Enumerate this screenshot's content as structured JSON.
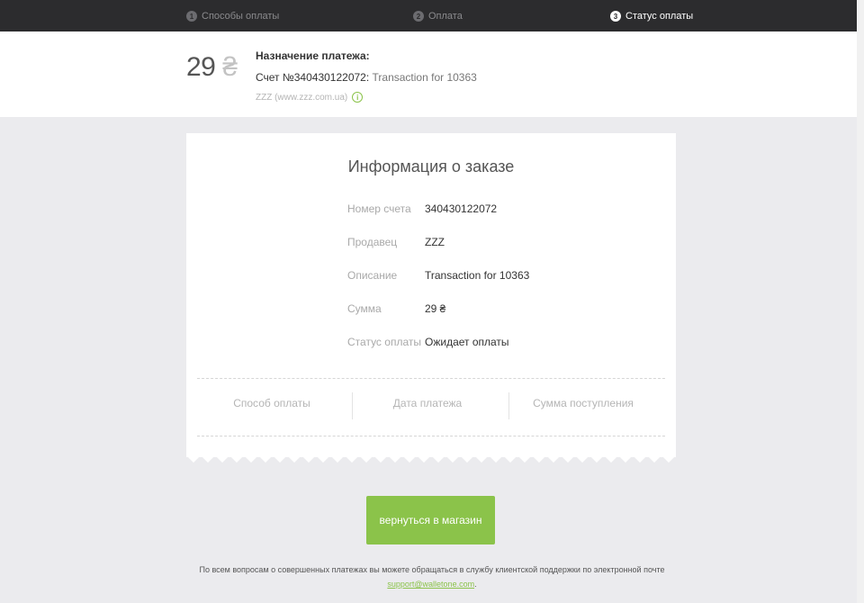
{
  "steps": [
    {
      "num": "1",
      "label": "Способы оплаты"
    },
    {
      "num": "2",
      "label": "Оплата"
    },
    {
      "num": "3",
      "label": "Статус оплаты"
    }
  ],
  "header": {
    "amount": "29",
    "currency": "₴",
    "purpose_title": "Назначение платежа:",
    "invoice_label": "Счет №340430122072:",
    "invoice_desc": " Transaction for 10363",
    "merchant": "ZZZ (www.zzz.com.ua)",
    "info_icon": "i"
  },
  "order": {
    "title": "Информация о заказе",
    "rows": [
      {
        "label": "Номер счета",
        "value": "340430122072"
      },
      {
        "label": "Продавец",
        "value": "ZZZ"
      },
      {
        "label": "Описание",
        "value": "Transaction for 10363"
      },
      {
        "label": "Сумма",
        "value": "29 ₴"
      },
      {
        "label": "Статус оплаты",
        "value": "Ожидает оплаты"
      }
    ],
    "columns": [
      "Способ оплаты",
      "Дата платежа",
      "Сумма поступления"
    ]
  },
  "actions": {
    "return_label": "вернуться в магазин"
  },
  "footer": {
    "text": "По всем вопросам о совершенных платежах вы можете обращаться в службу клиентской поддержки по электронной почте",
    "email": "support@walletone.com",
    "email_suffix": "."
  },
  "colors": {
    "accent": "#8bc34a",
    "topbar": "#2c2c2e",
    "page_bg": "#ebebee"
  }
}
